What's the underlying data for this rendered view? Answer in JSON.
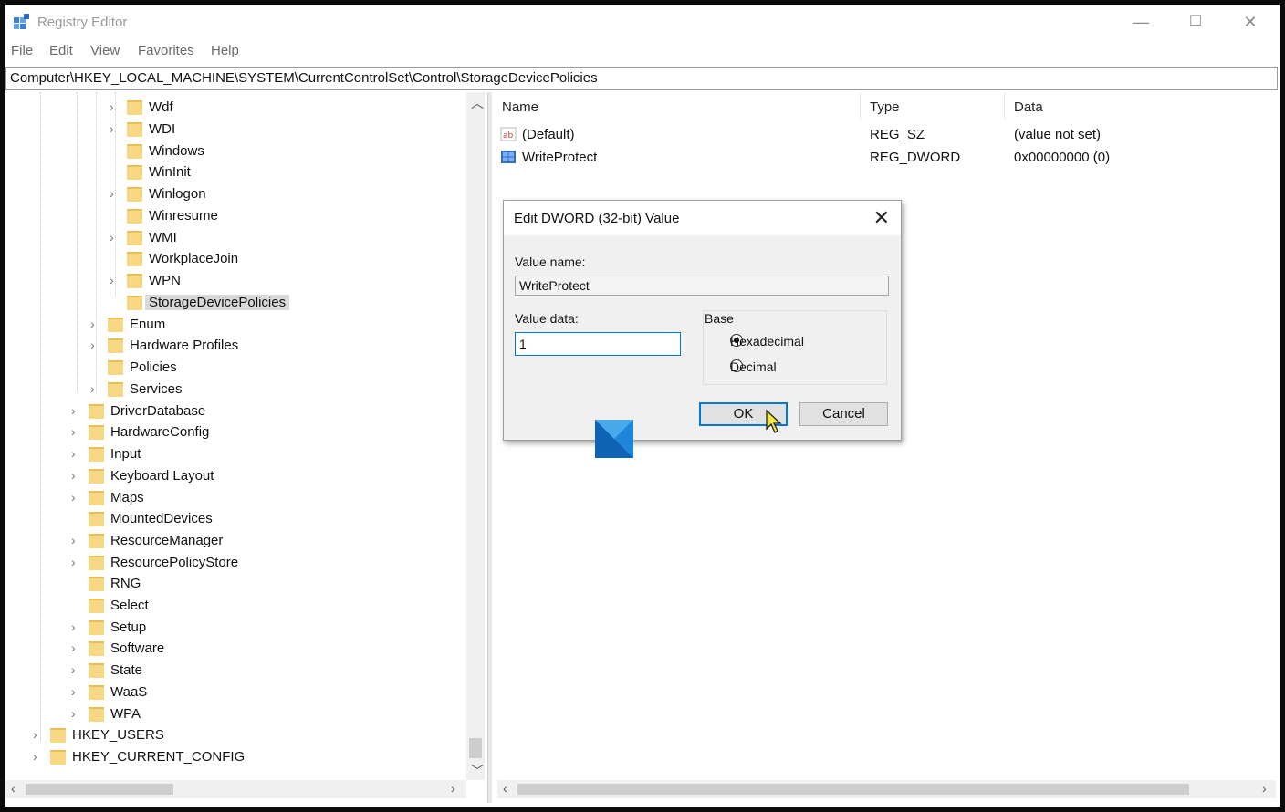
{
  "window": {
    "title": "Registry Editor",
    "controls": {
      "minimize": "—",
      "maximize": "☐",
      "close": "✕"
    }
  },
  "menu": [
    "File",
    "Edit",
    "View",
    "Favorites",
    "Help"
  ],
  "address": "Computer\\HKEY_LOCAL_MACHINE\\SYSTEM\\CurrentControlSet\\Control\\StorageDevicePolicies",
  "tree": {
    "level3": [
      "Wdf",
      "WDI",
      "Windows",
      "WinInit",
      "Winlogon",
      "Winresume",
      "WMI",
      "WorkplaceJoin",
      "WPN",
      "StorageDevicePolicies"
    ],
    "level2": [
      "Enum",
      "Hardware Profiles",
      "Policies",
      "Services"
    ],
    "level1": [
      "DriverDatabase",
      "HardwareConfig",
      "Input",
      "Keyboard Layout",
      "Maps",
      "MountedDevices",
      "ResourceManager",
      "ResourcePolicyStore",
      "RNG",
      "Select",
      "Setup",
      "Software",
      "State",
      "WaaS",
      "WPA"
    ],
    "level0": [
      "HKEY_USERS",
      "HKEY_CURRENT_CONFIG"
    ],
    "selected": "StorageDevicePolicies"
  },
  "list": {
    "columns": [
      "Name",
      "Type",
      "Data"
    ],
    "rows": [
      {
        "name": "(Default)",
        "type": "REG_SZ",
        "data": "(value not set)",
        "icon": "string-value-icon"
      },
      {
        "name": "WriteProtect",
        "type": "REG_DWORD",
        "data": "0x00000000 (0)",
        "icon": "binary-value-icon"
      }
    ]
  },
  "dialog": {
    "title": "Edit DWORD (32-bit) Value",
    "value_name_label": "Value name:",
    "value_name": "WriteProtect",
    "value_data_label": "Value data:",
    "value_data": "1",
    "base_label": "Base",
    "options": [
      {
        "label": "Hexadecimal",
        "selected": true
      },
      {
        "label": "Decimal",
        "selected": false
      }
    ],
    "ok_label": "OK",
    "cancel_label": "Cancel"
  },
  "colors": {
    "folder": "#f6d784",
    "accent": "#0078d7",
    "selection": "#d9d9d9"
  }
}
